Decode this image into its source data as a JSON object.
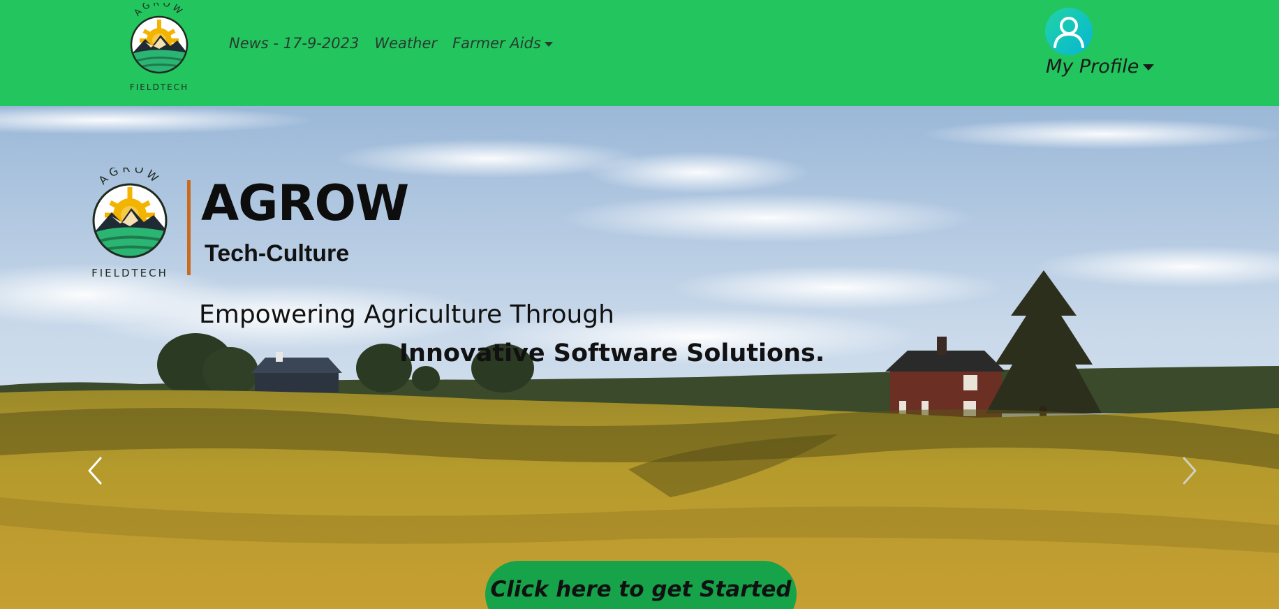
{
  "navbar": {
    "logo_text": {
      "top": "AGROW",
      "bottom": "FIELDTECH"
    },
    "links": [
      {
        "label": "News - 17-9-2023"
      },
      {
        "label": "Weather"
      },
      {
        "label": "Farmer Aids"
      }
    ],
    "profile_label": "My Profile"
  },
  "hero": {
    "logo_text": {
      "top": "AGROW",
      "bottom": "FIELDTECH"
    },
    "title": "AGROW",
    "subtitle": "Tech-Culture",
    "tagline_line1": "Empowering Agriculture Through",
    "tagline_line2": "Innovative Software Solutions.",
    "cta_label": "Click here to get Started"
  },
  "colors": {
    "navbar_bg": "#22c55e",
    "cta_bg": "#16a34a",
    "divider": "#c96a1f",
    "avatar_gradient": [
      "#22d3a5",
      "#06b6d4"
    ]
  },
  "icons": {
    "brand": "agrow-fieldtech-logo",
    "avatar": "user-avatar-icon",
    "dropdown": "caret-down-icon",
    "prev": "chevron-left-icon",
    "next": "chevron-right-icon"
  }
}
